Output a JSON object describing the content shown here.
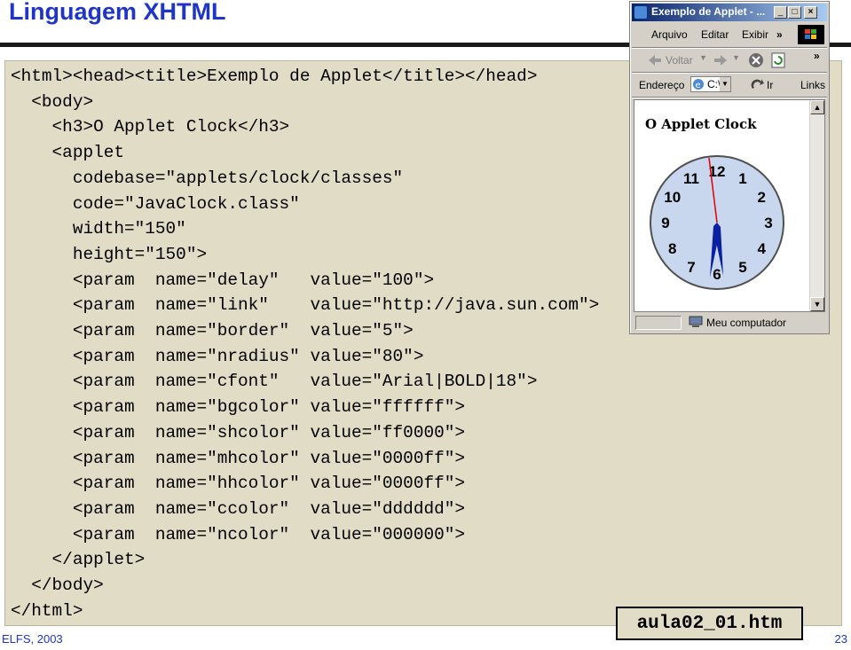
{
  "slide": {
    "title": "Linguagem XHTML",
    "footer_left": "ELFS, 2003",
    "page_number": "23",
    "file_label": "aula02_01.htm"
  },
  "code": [
    "<html><head><title>Exemplo de Applet</title></head>",
    "  <body>",
    "    <h3>O Applet Clock</h3>",
    "    <applet",
    "      codebase=\"applets/clock/classes\"",
    "      code=\"JavaClock.class\"",
    "      width=\"150\"",
    "      height=\"150\">",
    "      <param  name=\"delay\"   value=\"100\">",
    "      <param  name=\"link\"    value=\"http://java.sun.com\">",
    "      <param  name=\"border\"  value=\"5\">",
    "      <param  name=\"nradius\" value=\"80\">",
    "      <param  name=\"cfont\"   value=\"Arial|BOLD|18\">",
    "      <param  name=\"bgcolor\" value=\"ffffff\">",
    "      <param  name=\"shcolor\" value=\"ff0000\">",
    "      <param  name=\"mhcolor\" value=\"0000ff\">",
    "      <param  name=\"hhcolor\" value=\"0000ff\">",
    "      <param  name=\"ccolor\"  value=\"dddddd\">",
    "      <param  name=\"ncolor\"  value=\"000000\">",
    "    </applet>",
    "  </body>",
    "</html>"
  ],
  "browser": {
    "window_title": "Exemplo de Applet - ...",
    "menu": [
      "Arquivo",
      "Editar",
      "Exibir",
      "»"
    ],
    "toolbar_back": "Voltar",
    "address_label": "Endereço",
    "address_value": "C:\\",
    "go_label": "Ir",
    "links_label": "Links",
    "applet_heading": "O Applet Clock",
    "status_text": "Meu computador",
    "clock_numbers": [
      "12",
      "1",
      "2",
      "3",
      "4",
      "5",
      "6",
      "7",
      "8",
      "9",
      "10",
      "11"
    ],
    "clock_face_color": "#dddddd",
    "hand_color": "#0000ff",
    "second_hand_color": "#ff0000"
  },
  "colors": {
    "title_blue": "#1f35c7",
    "panel_bg": "#e0dcc6"
  }
}
